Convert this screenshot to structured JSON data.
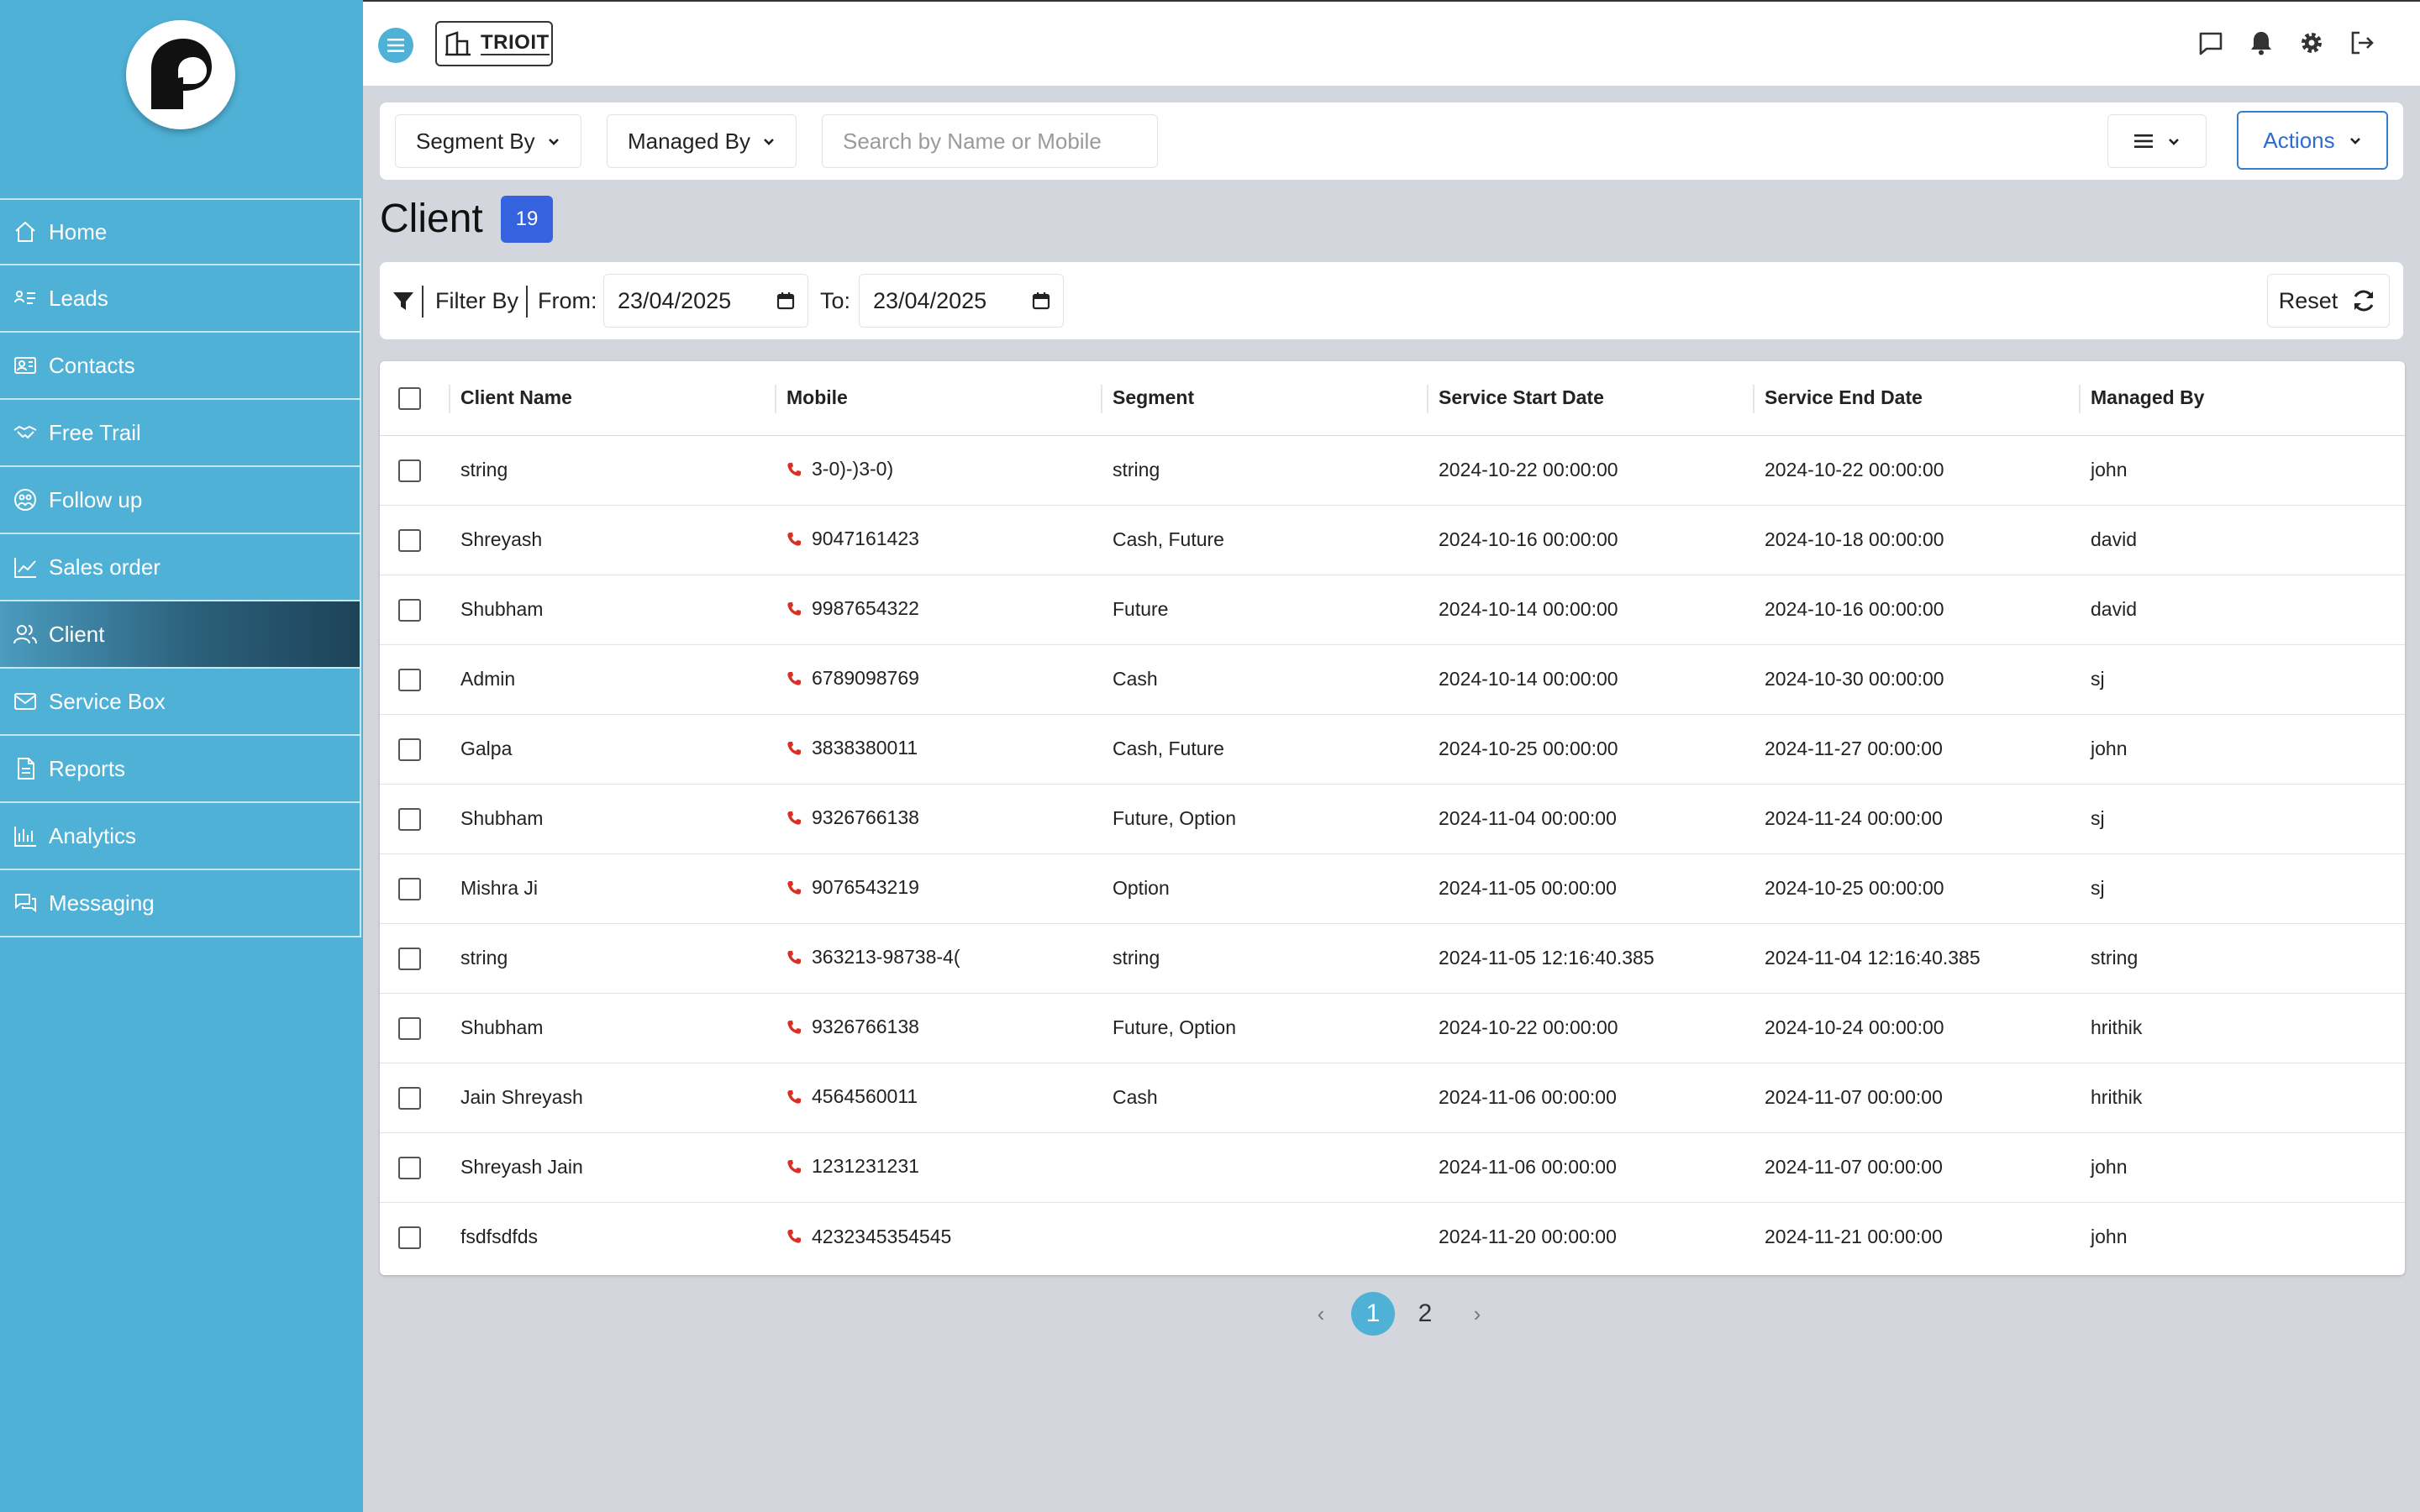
{
  "brand": {
    "name": "TRIOIT"
  },
  "sidebar": {
    "items": [
      {
        "label": "Home",
        "icon": "home-icon"
      },
      {
        "label": "Leads",
        "icon": "leads-icon"
      },
      {
        "label": "Contacts",
        "icon": "contacts-icon"
      },
      {
        "label": "Free Trail",
        "icon": "handshake-icon"
      },
      {
        "label": "Follow up",
        "icon": "followup-icon"
      },
      {
        "label": "Sales order",
        "icon": "chart-line-icon"
      },
      {
        "label": "Client",
        "icon": "users-icon",
        "active": true
      },
      {
        "label": "Service Box",
        "icon": "mail-icon"
      },
      {
        "label": "Reports",
        "icon": "file-icon"
      },
      {
        "label": "Analytics",
        "icon": "bar-chart-icon"
      },
      {
        "label": "Messaging",
        "icon": "chat-icon"
      }
    ]
  },
  "toolbar": {
    "segment_by": "Segment By",
    "managed_by": "Managed By",
    "search_placeholder": "Search by Name or Mobile",
    "actions": "Actions"
  },
  "page": {
    "title": "Client",
    "count": "19"
  },
  "filter": {
    "label": "Filter By",
    "from_label": "From:",
    "from_value": "23/04/2025",
    "to_label": "To:",
    "to_value": "23/04/2025",
    "reset": "Reset"
  },
  "table": {
    "headers": [
      "Client Name",
      "Mobile",
      "Segment",
      "Service Start Date",
      "Service End Date",
      "Managed By"
    ],
    "rows": [
      [
        "string",
        "3-0)-)3-0)",
        "string",
        "2024-10-22 00:00:00",
        "2024-10-22 00:00:00",
        "john"
      ],
      [
        "Shreyash",
        "9047161423",
        "Cash, Future",
        "2024-10-16 00:00:00",
        "2024-10-18 00:00:00",
        "david"
      ],
      [
        "Shubham",
        "9987654322",
        "Future",
        "2024-10-14 00:00:00",
        "2024-10-16 00:00:00",
        "david"
      ],
      [
        "Admin",
        "6789098769",
        "Cash",
        "2024-10-14 00:00:00",
        "2024-10-30 00:00:00",
        "sj"
      ],
      [
        "Galpa",
        "3838380011",
        "Cash, Future",
        "2024-10-25 00:00:00",
        "2024-11-27 00:00:00",
        "john"
      ],
      [
        "Shubham",
        "9326766138",
        "Future, Option",
        "2024-11-04 00:00:00",
        "2024-11-24 00:00:00",
        "sj"
      ],
      [
        "Mishra Ji",
        "9076543219",
        "Option",
        "2024-11-05 00:00:00",
        "2024-10-25 00:00:00",
        "sj"
      ],
      [
        "string",
        "363213-98738-4(",
        "string",
        "2024-11-05 12:16:40.385",
        "2024-11-04 12:16:40.385",
        "string"
      ],
      [
        "Shubham",
        "9326766138",
        "Future, Option",
        "2024-10-22 00:00:00",
        "2024-10-24 00:00:00",
        "hrithik"
      ],
      [
        "Jain Shreyash",
        "4564560011",
        "Cash",
        "2024-11-06 00:00:00",
        "2024-11-07 00:00:00",
        "hrithik"
      ],
      [
        "Shreyash Jain",
        "1231231231",
        "",
        "2024-11-06 00:00:00",
        "2024-11-07 00:00:00",
        "john"
      ],
      [
        "fsdfsdfds",
        "4232345354545",
        "",
        "2024-11-20 00:00:00",
        "2024-11-21 00:00:00",
        "john"
      ]
    ]
  },
  "pagination": {
    "prev": "‹",
    "pages": [
      "1",
      "2"
    ],
    "current": "1",
    "next": "›"
  },
  "colors": {
    "sidebar": "#4fb1d6",
    "active_nav": "#1d4358",
    "accent_blue": "#3563e0",
    "phone_icon": "#d93025"
  }
}
